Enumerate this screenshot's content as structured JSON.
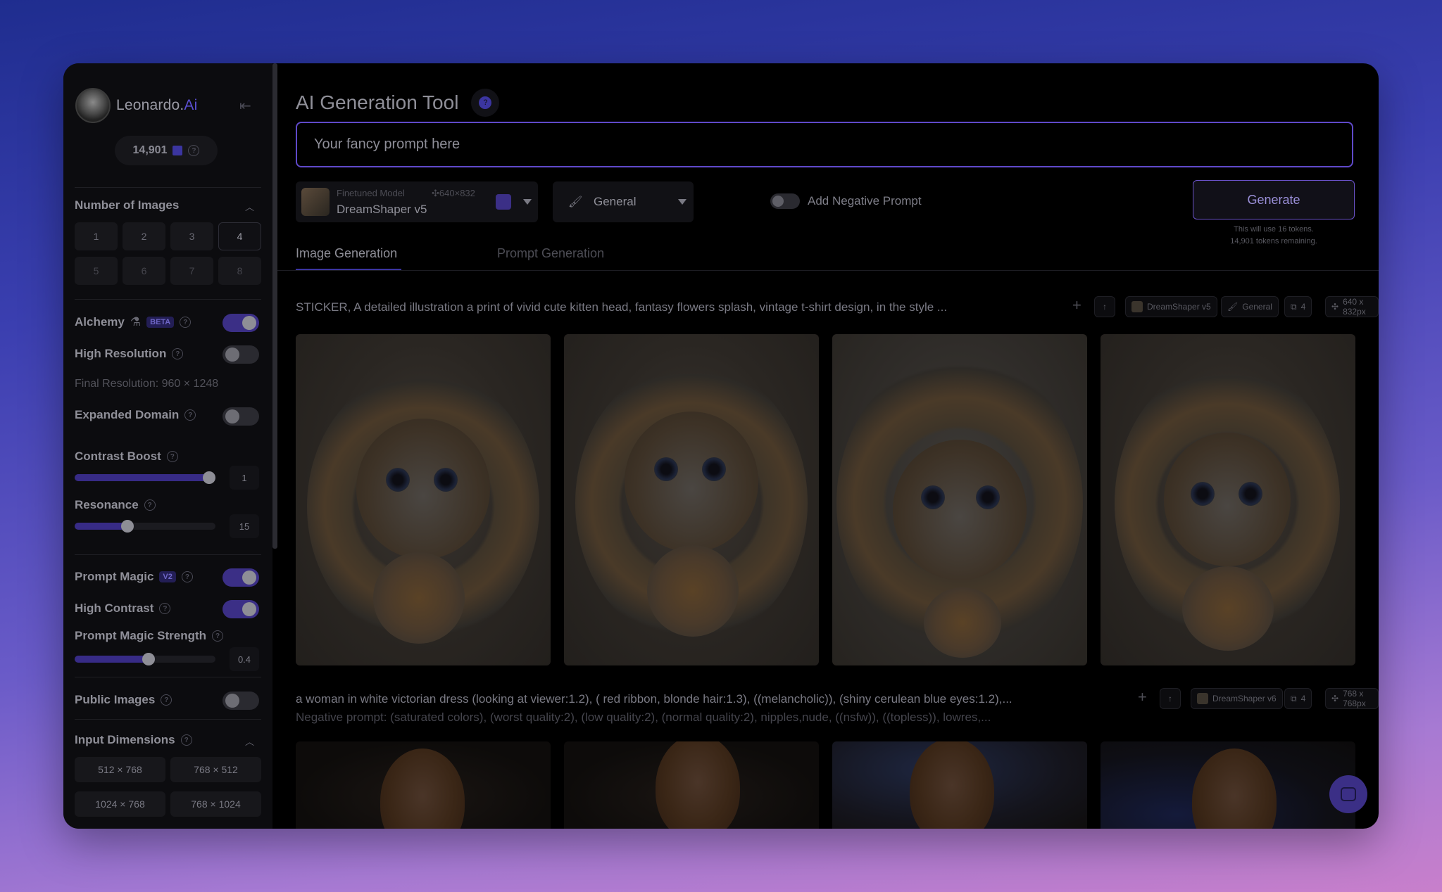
{
  "app": {
    "brand_main": "Leonardo.",
    "brand_accent": "Ai",
    "token_count": "14,901"
  },
  "sidebar": {
    "number_of_images": {
      "title": "Number of Images",
      "options": [
        "1",
        "2",
        "3",
        "4",
        "5",
        "6",
        "7",
        "8"
      ],
      "selected": "4"
    },
    "alchemy": {
      "label": "Alchemy",
      "badge": "BETA",
      "on": true
    },
    "high_resolution": {
      "label": "High Resolution",
      "on": false
    },
    "final_resolution": "Final Resolution: 960 × 1248",
    "expanded_domain": {
      "label": "Expanded Domain",
      "on": false
    },
    "contrast_boost": {
      "label": "Contrast Boost",
      "value": "1",
      "fraction": 1.0
    },
    "resonance": {
      "label": "Resonance",
      "value": "15",
      "fraction": 0.36
    },
    "prompt_magic": {
      "label": "Prompt Magic",
      "badge": "V2",
      "on": true
    },
    "high_contrast": {
      "label": "High Contrast",
      "on": true
    },
    "prompt_magic_strength": {
      "label": "Prompt Magic Strength",
      "value": "0.4",
      "fraction": 0.53
    },
    "public_images": {
      "label": "Public Images",
      "on": false
    },
    "input_dimensions": {
      "title": "Input Dimensions",
      "options": [
        "512 × 768",
        "768 × 512",
        "1024 × 768",
        "768 × 1024"
      ]
    }
  },
  "main": {
    "title": "AI Generation Tool",
    "prompt_placeholder": "Your fancy prompt here",
    "model": {
      "sub_label": "Finetuned Model",
      "size": "640×832",
      "name": "DreamShaper v5"
    },
    "style": {
      "label": "General"
    },
    "negative_prompt_label": "Add Negative Prompt",
    "generate_label": "Generate",
    "generate_note_1": "This will use 16 tokens.",
    "generate_note_2": "14,901 tokens remaining.",
    "tabs": [
      {
        "label": "Image Generation",
        "active": true
      },
      {
        "label": "Prompt Generation",
        "active": false
      }
    ]
  },
  "generations": [
    {
      "prompt": "STICKER, A detailed illustration a print of vivid cute kitten head, fantasy flowers splash, vintage t-shirt design, in the style ...",
      "model": "DreamShaper v5",
      "style": "General",
      "count": "4",
      "size": "640 x 832px"
    },
    {
      "prompt": "a woman in white victorian dress (looking at viewer:1.2), ( red ribbon, blonde hair:1.3), ((melancholic)), (shiny cerulean blue eyes:1.2),...",
      "negative": "Negative prompt: (saturated colors), (worst quality:2), (low quality:2), (normal quality:2), nipples,nude, ((nsfw)), ((topless)), lowres,...",
      "model": "DreamShaper v6",
      "count": "4",
      "size": "768 x 768px"
    }
  ],
  "icons": {
    "collapse": "collapse-sidebar-icon",
    "coin": "token-coin-icon",
    "help": "help-icon",
    "chevron": "chevron-up-icon",
    "chat": "chat-icon"
  },
  "colors": {
    "accent": "#5f49c9",
    "toggle_on": "#3b2f86"
  }
}
